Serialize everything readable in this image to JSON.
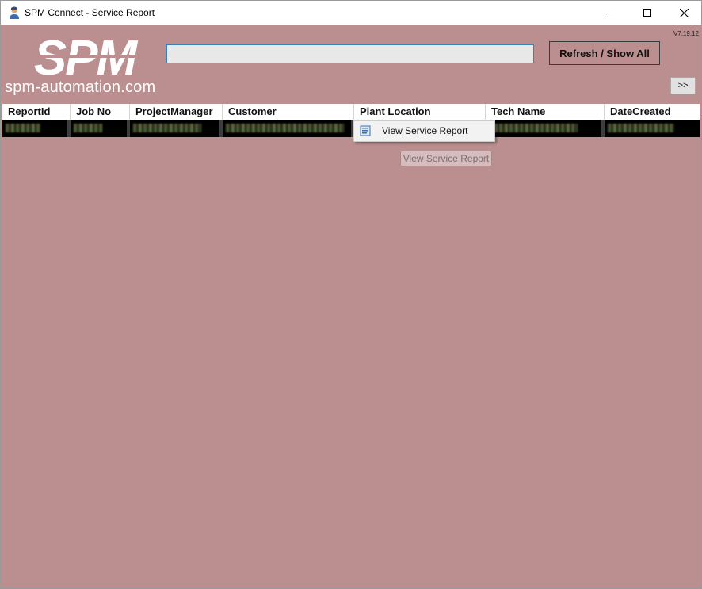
{
  "window": {
    "title": "SPM Connect - Service Report",
    "version": "V7.19.12",
    "controls": {
      "minimize": "minimize-icon",
      "maximize": "maximize-icon",
      "close": "close-icon"
    }
  },
  "header": {
    "logo_text": "SPM",
    "url": "spm-automation.com",
    "search": {
      "value": "",
      "placeholder": ""
    },
    "refresh_label": "Refresh / Show All",
    "expand_label": ">>"
  },
  "grid": {
    "columns": [
      "ReportId",
      "Job No",
      "ProjectManager",
      "Customer",
      "Plant Location",
      "Tech Name",
      "DateCreated"
    ],
    "rows_visible": 1,
    "row_content": "obscured"
  },
  "context_menu": {
    "items": [
      {
        "label": "View Service Report",
        "icon": "report-icon"
      }
    ]
  },
  "tooltip": {
    "text": "View Service Report"
  },
  "colors": {
    "background": "#bb8f8f",
    "search_border": "#3c7fb1",
    "row_background": "#000000"
  }
}
